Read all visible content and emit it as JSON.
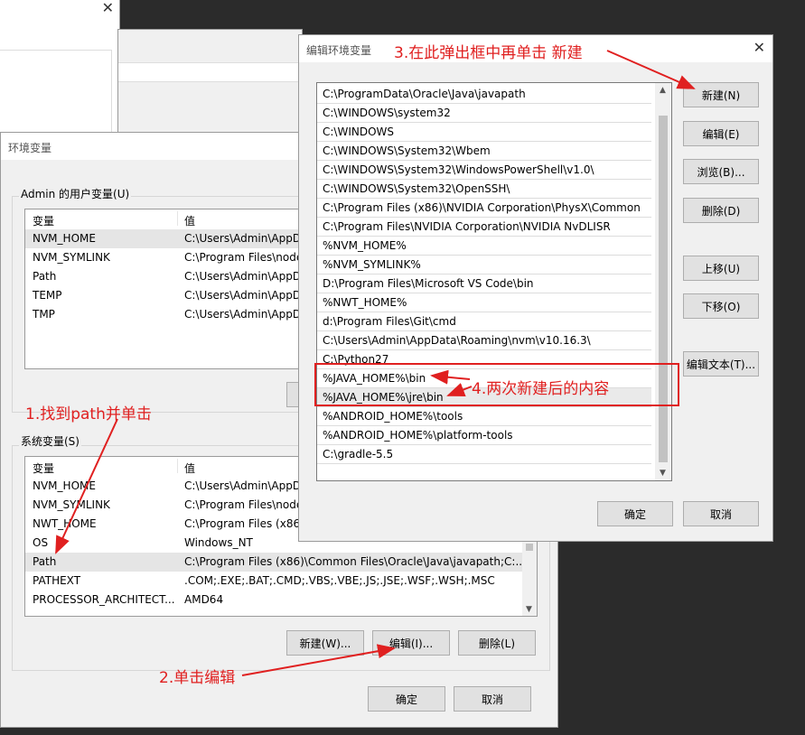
{
  "env_dialog": {
    "title": "环境变量",
    "user_group_label": "Admin 的用户变量(U)",
    "system_group_label": "系统变量(S)",
    "col_var": "变量",
    "col_val": "值",
    "user_rows": [
      {
        "name": "NVM_HOME",
        "value": "C:\\Users\\Admin\\AppD"
      },
      {
        "name": "NVM_SYMLINK",
        "value": "C:\\Program Files\\node"
      },
      {
        "name": "Path",
        "value": "C:\\Users\\Admin\\AppD"
      },
      {
        "name": "TEMP",
        "value": "C:\\Users\\Admin\\AppD"
      },
      {
        "name": "TMP",
        "value": "C:\\Users\\Admin\\AppD"
      }
    ],
    "system_rows": [
      {
        "name": "NVM_HOME",
        "value": "C:\\Users\\Admin\\AppD"
      },
      {
        "name": "NVM_SYMLINK",
        "value": "C:\\Program Files\\node"
      },
      {
        "name": "NWT_HOME",
        "value": "C:\\Program Files (x86)"
      },
      {
        "name": "OS",
        "value": "Windows_NT"
      },
      {
        "name": "Path",
        "value": "C:\\Program Files (x86)\\Common Files\\Oracle\\Java\\javapath;C:..."
      },
      {
        "name": "PATHEXT",
        "value": ".COM;.EXE;.BAT;.CMD;.VBS;.VBE;.JS;.JSE;.WSF;.WSH;.MSC"
      },
      {
        "name": "PROCESSOR_ARCHITECT...",
        "value": "AMD64"
      }
    ],
    "btn_new": "新建(W)...",
    "btn_edit": "编辑(I)...",
    "btn_delete": "删除(L)",
    "btn_ok": "确定",
    "btn_cancel": "取消"
  },
  "edit_dialog": {
    "title": "编辑环境变量",
    "paths": [
      "C:\\ProgramData\\Oracle\\Java\\javapath",
      "C:\\WINDOWS\\system32",
      "C:\\WINDOWS",
      "C:\\WINDOWS\\System32\\Wbem",
      "C:\\WINDOWS\\System32\\WindowsPowerShell\\v1.0\\",
      "C:\\WINDOWS\\System32\\OpenSSH\\",
      "C:\\Program Files (x86)\\NVIDIA Corporation\\PhysX\\Common",
      "C:\\Program Files\\NVIDIA Corporation\\NVIDIA NvDLISR",
      "%NVM_HOME%",
      "%NVM_SYMLINK%",
      "D:\\Program Files\\Microsoft VS Code\\bin",
      "%NWT_HOME%",
      "d:\\Program Files\\Git\\cmd",
      "C:\\Users\\Admin\\AppData\\Roaming\\nvm\\v10.16.3\\",
      "C:\\Python27",
      "%JAVA_HOME%\\bin",
      "%JAVA_HOME%\\jre\\bin",
      "%ANDROID_HOME%\\tools",
      "%ANDROID_HOME%\\platform-tools",
      "C:\\gradle-5.5"
    ],
    "btn_new": "新建(N)",
    "btn_edit": "编辑(E)",
    "btn_browse": "浏览(B)...",
    "btn_delete": "删除(D)",
    "btn_up": "上移(U)",
    "btn_down": "下移(O)",
    "btn_edit_text": "编辑文本(T)...",
    "btn_ok": "确定",
    "btn_cancel": "取消"
  },
  "annotations": {
    "step1": "1.找到path并单击",
    "step2": "2.单击编辑",
    "step3": "3.在此弹出框中再单击 新建",
    "step4": "4.两次新建后的内容",
    "color": "#e02020"
  }
}
